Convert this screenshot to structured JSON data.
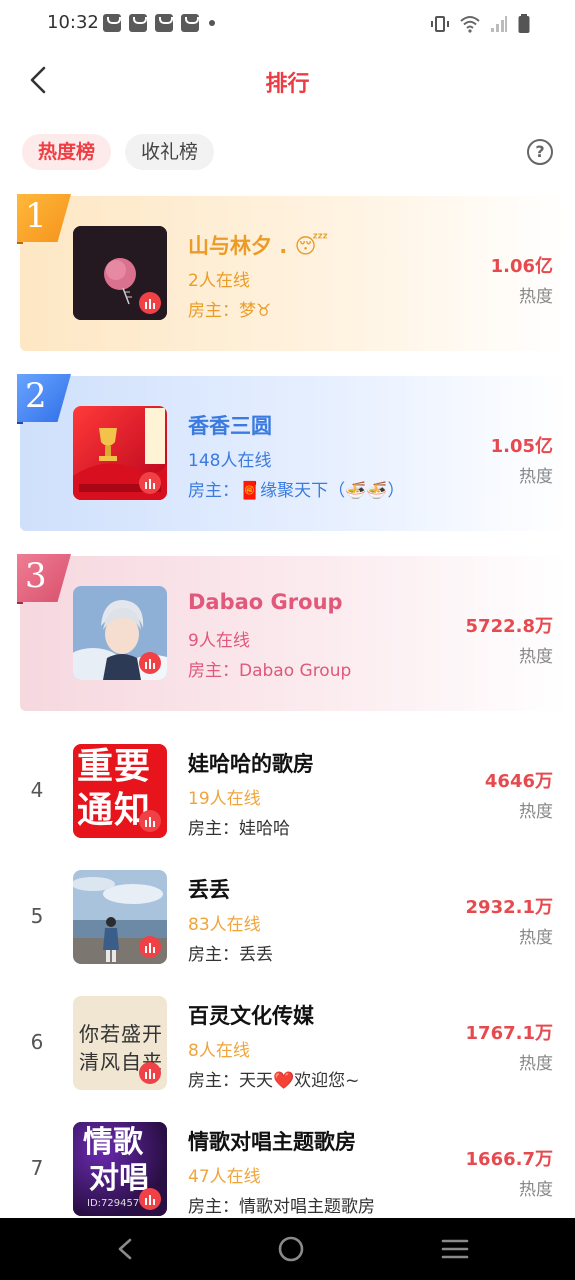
{
  "status_bar": {
    "time": "10:32"
  },
  "header": {
    "title": "排行",
    "back_icon": "chevron-left-icon"
  },
  "tabs": [
    {
      "label": "热度榜",
      "active": true
    },
    {
      "label": "收礼榜",
      "active": false
    }
  ],
  "help_icon": "question-circle-icon",
  "owner_prefix": "房主：",
  "rankings": [
    {
      "rank": "1",
      "name": "山与林夕 . 😴",
      "online": "2人在线",
      "owner": "梦♉",
      "heat": "1.06亿",
      "heat_label": "热度"
    },
    {
      "rank": "2",
      "name": "香香三圆",
      "online": "148人在线",
      "owner": "🧧缘聚天下（🍜🍜）",
      "heat": "1.05亿",
      "heat_label": "热度"
    },
    {
      "rank": "3",
      "name": "Dabao Group",
      "online": "9人在线",
      "owner": "Dabao Group",
      "heat": "5722.8万",
      "heat_label": "热度"
    },
    {
      "rank": "4",
      "name": "娃哈哈的歌房",
      "online": "19人在线",
      "owner": "娃哈哈",
      "heat": "4646万",
      "heat_label": "热度",
      "avatar_text": [
        "重要",
        "通知"
      ]
    },
    {
      "rank": "5",
      "name": "丢丢",
      "online": "83人在线",
      "owner": "丢丢",
      "heat": "2932.1万",
      "heat_label": "热度"
    },
    {
      "rank": "6",
      "name": "百灵文化传媒",
      "online": "8人在线",
      "owner": "天天❤️欢迎您~",
      "heat": "1767.1万",
      "heat_label": "热度",
      "avatar_text": [
        "你若盛开",
        "清风自来"
      ]
    },
    {
      "rank": "7",
      "name": "情歌对唱主题歌房",
      "online": "47人在线",
      "owner": "情歌对唱主题歌房",
      "heat": "1666.7万",
      "heat_label": "热度",
      "avatar_text": [
        "情歌",
        "对唱",
        "ID:729457"
      ]
    }
  ],
  "colors": {
    "accent": "#ee3a42",
    "gold": "#eb9c28",
    "blue": "#3b7be0",
    "pink": "#e0587a",
    "online_orange": "#f0a43a"
  },
  "nav_bar": {
    "back": "triangle-back-icon",
    "home": "circle-home-icon",
    "menu": "hamburger-menu-icon"
  }
}
